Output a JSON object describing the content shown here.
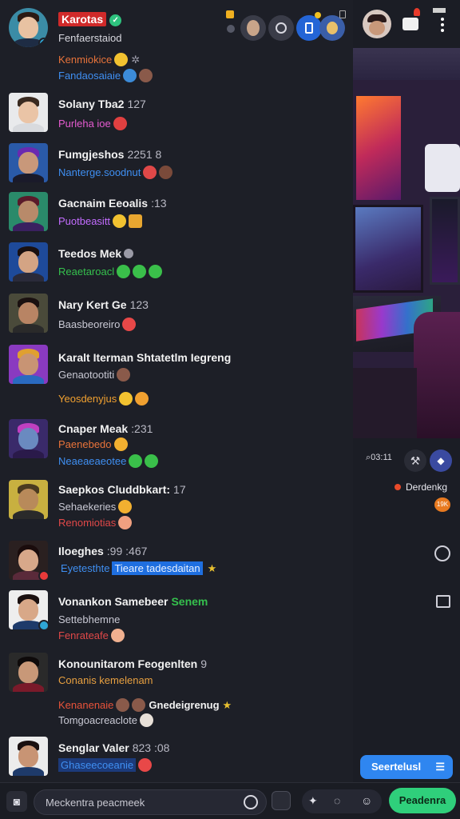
{
  "header": {
    "channel_name": "Karotas",
    "channel_sub": "Fenfaerstaiod",
    "line1": "Kenmiokice",
    "line2": "Fandaosaiaie"
  },
  "messages": [
    {
      "name": "Solany Tba2",
      "meta": "127",
      "lines": [
        {
          "text": "Purleha ioe",
          "color": "#e55bd0"
        }
      ]
    },
    {
      "name": "Fumgjeshos",
      "meta": "2251 8",
      "lines": [
        {
          "text": "Nanterge.soodnut",
          "color": "#3f8ff2"
        }
      ]
    },
    {
      "name": "Gacnaim Eeoalis",
      "meta": ":13",
      "lines": [
        {
          "text": "Puotbeasitt",
          "color": "#c36cff"
        }
      ]
    },
    {
      "name": "Teedos Mek",
      "meta": "",
      "lines": [
        {
          "text": "Reaetaroacl",
          "color": "#35c04d"
        }
      ]
    },
    {
      "name": "Nary Kert Ge",
      "meta": "123",
      "lines": [
        {
          "text": "Baasbeoreiro",
          "color": "#c9c9d4"
        }
      ]
    },
    {
      "name": "Karalt Iterman Shtatetlm Iegreng",
      "meta": "",
      "lines": [
        {
          "text": "Genaotootiti",
          "color": "#c9c9d4"
        },
        {
          "text": "Yeosdenyjus",
          "color": "#f0a030"
        }
      ]
    },
    {
      "name": "Cnaper Meak",
      "meta": ":231",
      "lines": [
        {
          "text": "Paenebedo",
          "color": "#e8733a"
        },
        {
          "text": "Neaeaeaeotee",
          "color": "#3f8ff2"
        }
      ]
    },
    {
      "name": "Saepkos Cluddbkart:",
      "meta": "17",
      "lines": [
        {
          "text": "Sehaekeries",
          "color": "#c9c9d4"
        },
        {
          "text": "Renomiotias",
          "color": "#e04848"
        }
      ]
    },
    {
      "name": "Iloeghes",
      "meta": ":99 :467",
      "lines": [
        {
          "text": "Eyetesthte",
          "color": "#3f8ff2"
        },
        {
          "text": "Tieare tadesdaitan",
          "color": "#e9f1ff"
        }
      ]
    },
    {
      "name": "Vonankon Samebeer",
      "meta": "Senem",
      "lines": [
        {
          "text": "Settebhemne",
          "color": "#c9c9d4"
        },
        {
          "text": "Fenrateafe",
          "color": "#e04848"
        }
      ]
    },
    {
      "name": "Konounitarom Feogenlten",
      "meta": "9",
      "lines": [
        {
          "text": "Conanis kemelenam",
          "color": "#e8a040"
        },
        {
          "text": "Kenanenaie",
          "color": "#e8533a"
        },
        {
          "text": "Tomgoacreaclote",
          "color": "#c9c9d4"
        }
      ]
    },
    {
      "name": "Senglar Valer",
      "meta": "823 :08",
      "lines": [
        {
          "text": "Ghaseecoeanie",
          "color": "#3f8ff2"
        }
      ]
    }
  ],
  "extra_texts": {
    "gendelgreng": "Gnedeigrenug"
  },
  "side": {
    "stream_stat": "03:11",
    "live_label": "Derdenkg",
    "live_badge": "19K",
    "subscribe_label": "Seertelusl"
  },
  "composer": {
    "placeholder": "Meckentra peacmeek",
    "send_label": "Peadenra"
  },
  "colors": {
    "send": "#2fcf7b",
    "subscribe": "#2f86f0",
    "live": "#e84a2a",
    "verified": "#2ec27e"
  }
}
